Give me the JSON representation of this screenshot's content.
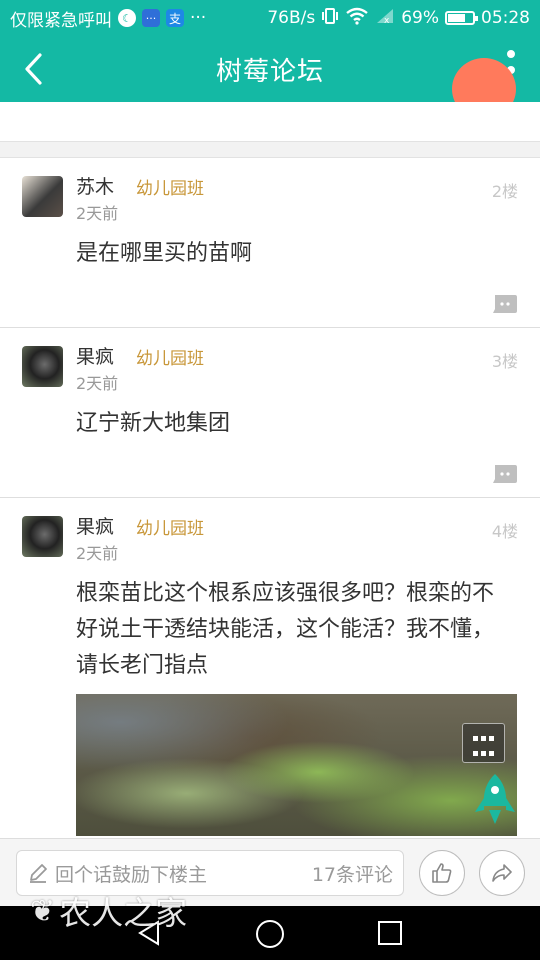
{
  "status_bar": {
    "carrier": "仅限紧急呼叫",
    "ellipsis": "···",
    "speed": "76B/s",
    "battery_text": "69%",
    "battery_level": 0.69,
    "time": "05:28",
    "alipay_glyph": "支"
  },
  "app_bar": {
    "title": "树莓论坛",
    "back_icon": "chevron-left-icon",
    "more_icon": "more-vertical-icon"
  },
  "comments": [
    {
      "name": "苏木",
      "tag": "幼儿园班",
      "time": "2天前",
      "floor": "2楼",
      "content": "是在哪里买的苗啊"
    },
    {
      "name": "果疯",
      "tag": "幼儿园班",
      "time": "2天前",
      "floor": "3楼",
      "content": "辽宁新大地集团"
    },
    {
      "name": "果疯",
      "tag": "幼儿园班",
      "time": "2天前",
      "floor": "4楼",
      "content": "根栾苗比这个根系应该强很多吧？根栾的不好说土干透结块能活，这个能活？我不懂，请长老门指点"
    }
  ],
  "bottom_bar": {
    "placeholder": "回个话鼓励下楼主",
    "comment_count": "17条评论",
    "like_icon": "thumbs-up-icon",
    "share_icon": "share-icon"
  },
  "watermark": {
    "text": "农人之家"
  },
  "colors": {
    "brand": "#14b9a4",
    "tag": "#c8973a",
    "fab_orange": "#ff7a5c",
    "rocket": "#1bb89f"
  }
}
